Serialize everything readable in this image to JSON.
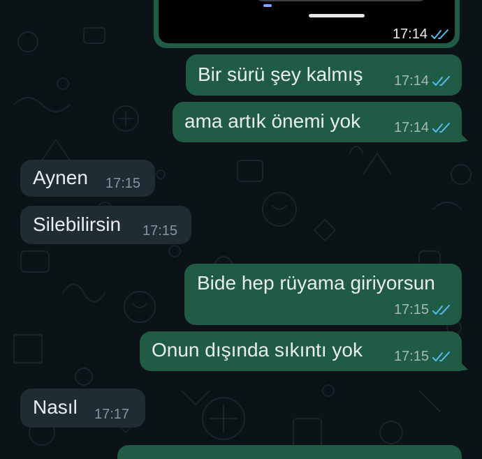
{
  "media_message": {
    "time": "17:14",
    "status": "read"
  },
  "messages": [
    {
      "id": "m1",
      "direction": "out",
      "text": "Bir sürü şey kalmış",
      "time": "17:14",
      "status": "read"
    },
    {
      "id": "m2",
      "direction": "out",
      "text": "ama artık önemi yok",
      "time": "17:14",
      "status": "read"
    },
    {
      "id": "m3",
      "direction": "in",
      "text": "Aynen",
      "time": "17:15"
    },
    {
      "id": "m4",
      "direction": "in",
      "text": "Silebilirsin",
      "time": "17:15"
    },
    {
      "id": "m5",
      "direction": "out",
      "text": "Bide hep rüyama giriyorsun",
      "time": "17:15",
      "status": "read"
    },
    {
      "id": "m6",
      "direction": "out",
      "text": "Onun dışında sıkıntı yok",
      "time": "17:15",
      "status": "read"
    },
    {
      "id": "m7",
      "direction": "in",
      "text": "Nasıl",
      "time": "17:17"
    }
  ],
  "colors": {
    "background": "#0c1317",
    "outgoing_bubble": "#1f5b45",
    "incoming_bubble": "#202c33",
    "read_ticks": "#53bdeb",
    "text": "#e9edef"
  },
  "icons": {
    "read_receipt": "double-check-icon"
  }
}
